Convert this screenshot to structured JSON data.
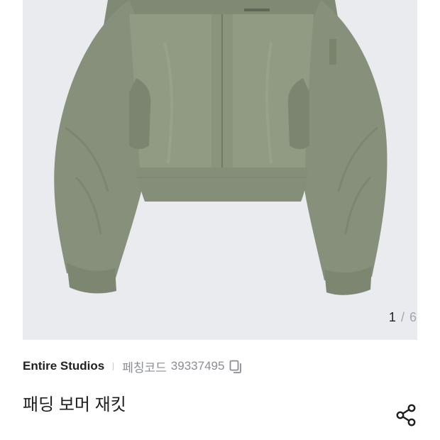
{
  "gallery": {
    "current": "1",
    "separator": "/",
    "total": "6",
    "image_alt": "sage green padded bomber jacket product photo"
  },
  "product": {
    "brand": "Entire Studios",
    "code_label": "페칭코드",
    "code": "39337495",
    "title": "패딩 보머 재킷"
  },
  "icons": {
    "copy": "copy-icon",
    "share": "share-icon"
  },
  "colors": {
    "gallery_bg": "#e9ebef",
    "jacket": "#8b957d",
    "text_primary": "#222222",
    "text_secondary": "#8a8d93"
  }
}
